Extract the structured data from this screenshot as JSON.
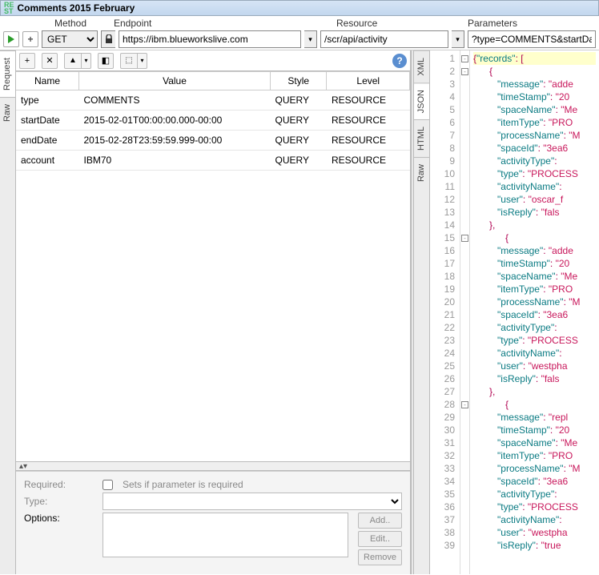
{
  "title": "Comments 2015 February",
  "toolbar": {
    "method_label": "Method",
    "endpoint_label": "Endpoint",
    "resource_label": "Resource",
    "parameters_label": "Parameters",
    "method_value": "GET",
    "endpoint_value": "https://ibm.blueworkslive.com",
    "resource_value": "/scr/api/activity",
    "parameters_value": "?type=COMMENTS&startDat"
  },
  "left_tabs": [
    "Request",
    "Raw"
  ],
  "left_tabs_active": 0,
  "right_tabs": [
    "XML",
    "JSON",
    "HTML",
    "Raw"
  ],
  "right_tabs_active": 1,
  "table": {
    "headers": [
      "Name",
      "Value",
      "Style",
      "Level"
    ],
    "rows": [
      {
        "name": "type",
        "value": "COMMENTS",
        "style": "QUERY",
        "level": "RESOURCE"
      },
      {
        "name": "startDate",
        "value": "2015-02-01T00:00:00.000-00:00",
        "style": "QUERY",
        "level": "RESOURCE"
      },
      {
        "name": "endDate",
        "value": "2015-02-28T23:59:59.999-00:00",
        "style": "QUERY",
        "level": "RESOURCE"
      },
      {
        "name": "account",
        "value": "IBM70",
        "style": "QUERY",
        "level": "RESOURCE"
      }
    ]
  },
  "bottom": {
    "required_label": "Required:",
    "required_text": "Sets if parameter is required",
    "type_label": "Type:",
    "options_label": "Options:",
    "btn_add": "Add..",
    "btn_edit": "Edit..",
    "btn_remove": "Remove"
  },
  "json_lines": [
    {
      "n": 1,
      "fold": "-",
      "hl": true,
      "t": [
        [
          "brace",
          "{"
        ],
        [
          "key",
          "\"records\""
        ],
        [
          "punc",
          ": ["
        ]
      ]
    },
    {
      "n": 2,
      "fold": "-",
      "t": [
        [
          "plain",
          "      "
        ],
        [
          "brace",
          "{"
        ]
      ]
    },
    {
      "n": 3,
      "t": [
        [
          "plain",
          "         "
        ],
        [
          "key",
          "\"message\""
        ],
        [
          "punc",
          ": "
        ],
        [
          "str",
          "\"adde"
        ]
      ]
    },
    {
      "n": 4,
      "t": [
        [
          "plain",
          "         "
        ],
        [
          "key",
          "\"timeStamp\""
        ],
        [
          "punc",
          ": "
        ],
        [
          "str",
          "\"20"
        ]
      ]
    },
    {
      "n": 5,
      "t": [
        [
          "plain",
          "         "
        ],
        [
          "key",
          "\"spaceName\""
        ],
        [
          "punc",
          ": "
        ],
        [
          "str",
          "\"Me"
        ]
      ]
    },
    {
      "n": 6,
      "t": [
        [
          "plain",
          "         "
        ],
        [
          "key",
          "\"itemType\""
        ],
        [
          "punc",
          ": "
        ],
        [
          "str",
          "\"PRO"
        ]
      ]
    },
    {
      "n": 7,
      "t": [
        [
          "plain",
          "         "
        ],
        [
          "key",
          "\"processName\""
        ],
        [
          "punc",
          ": "
        ],
        [
          "str",
          "\"M"
        ]
      ]
    },
    {
      "n": 8,
      "t": [
        [
          "plain",
          "         "
        ],
        [
          "key",
          "\"spaceId\""
        ],
        [
          "punc",
          ": "
        ],
        [
          "str",
          "\"3ea6"
        ]
      ]
    },
    {
      "n": 9,
      "t": [
        [
          "plain",
          "         "
        ],
        [
          "key",
          "\"activityType\""
        ],
        [
          "punc",
          ":"
        ]
      ]
    },
    {
      "n": 10,
      "t": [
        [
          "plain",
          "         "
        ],
        [
          "key",
          "\"type\""
        ],
        [
          "punc",
          ": "
        ],
        [
          "str",
          "\"PROCESS"
        ]
      ]
    },
    {
      "n": 11,
      "t": [
        [
          "plain",
          "         "
        ],
        [
          "key",
          "\"activityName\""
        ],
        [
          "punc",
          ":"
        ]
      ]
    },
    {
      "n": 12,
      "t": [
        [
          "plain",
          "         "
        ],
        [
          "key",
          "\"user\""
        ],
        [
          "punc",
          ": "
        ],
        [
          "str",
          "\"oscar_f"
        ]
      ]
    },
    {
      "n": 13,
      "t": [
        [
          "plain",
          "         "
        ],
        [
          "key",
          "\"isReply\""
        ],
        [
          "punc",
          ": "
        ],
        [
          "str",
          "\"fals"
        ]
      ]
    },
    {
      "n": 14,
      "t": [
        [
          "plain",
          "      "
        ],
        [
          "brace",
          "},"
        ]
      ]
    },
    {
      "n": 15,
      "fold": "-",
      "t": [
        [
          "plain",
          "            "
        ],
        [
          "brace",
          "{"
        ]
      ]
    },
    {
      "n": 16,
      "t": [
        [
          "plain",
          "         "
        ],
        [
          "key",
          "\"message\""
        ],
        [
          "punc",
          ": "
        ],
        [
          "str",
          "\"adde"
        ]
      ]
    },
    {
      "n": 17,
      "t": [
        [
          "plain",
          "         "
        ],
        [
          "key",
          "\"timeStamp\""
        ],
        [
          "punc",
          ": "
        ],
        [
          "str",
          "\"20"
        ]
      ]
    },
    {
      "n": 18,
      "t": [
        [
          "plain",
          "         "
        ],
        [
          "key",
          "\"spaceName\""
        ],
        [
          "punc",
          ": "
        ],
        [
          "str",
          "\"Me"
        ]
      ]
    },
    {
      "n": 19,
      "t": [
        [
          "plain",
          "         "
        ],
        [
          "key",
          "\"itemType\""
        ],
        [
          "punc",
          ": "
        ],
        [
          "str",
          "\"PRO"
        ]
      ]
    },
    {
      "n": 20,
      "t": [
        [
          "plain",
          "         "
        ],
        [
          "key",
          "\"processName\""
        ],
        [
          "punc",
          ": "
        ],
        [
          "str",
          "\"M"
        ]
      ]
    },
    {
      "n": 21,
      "t": [
        [
          "plain",
          "         "
        ],
        [
          "key",
          "\"spaceId\""
        ],
        [
          "punc",
          ": "
        ],
        [
          "str",
          "\"3ea6"
        ]
      ]
    },
    {
      "n": 22,
      "t": [
        [
          "plain",
          "         "
        ],
        [
          "key",
          "\"activityType\""
        ],
        [
          "punc",
          ":"
        ]
      ]
    },
    {
      "n": 23,
      "t": [
        [
          "plain",
          "         "
        ],
        [
          "key",
          "\"type\""
        ],
        [
          "punc",
          ": "
        ],
        [
          "str",
          "\"PROCESS"
        ]
      ]
    },
    {
      "n": 24,
      "t": [
        [
          "plain",
          "         "
        ],
        [
          "key",
          "\"activityName\""
        ],
        [
          "punc",
          ":"
        ]
      ]
    },
    {
      "n": 25,
      "t": [
        [
          "plain",
          "         "
        ],
        [
          "key",
          "\"user\""
        ],
        [
          "punc",
          ": "
        ],
        [
          "str",
          "\"westpha"
        ]
      ]
    },
    {
      "n": 26,
      "t": [
        [
          "plain",
          "         "
        ],
        [
          "key",
          "\"isReply\""
        ],
        [
          "punc",
          ": "
        ],
        [
          "str",
          "\"fals"
        ]
      ]
    },
    {
      "n": 27,
      "t": [
        [
          "plain",
          "      "
        ],
        [
          "brace",
          "},"
        ]
      ]
    },
    {
      "n": 28,
      "fold": "-",
      "t": [
        [
          "plain",
          "            "
        ],
        [
          "brace",
          "{"
        ]
      ]
    },
    {
      "n": 29,
      "t": [
        [
          "plain",
          "         "
        ],
        [
          "key",
          "\"message\""
        ],
        [
          "punc",
          ": "
        ],
        [
          "str",
          "\"repl"
        ]
      ]
    },
    {
      "n": 30,
      "t": [
        [
          "plain",
          "         "
        ],
        [
          "key",
          "\"timeStamp\""
        ],
        [
          "punc",
          ": "
        ],
        [
          "str",
          "\"20"
        ]
      ]
    },
    {
      "n": 31,
      "t": [
        [
          "plain",
          "         "
        ],
        [
          "key",
          "\"spaceName\""
        ],
        [
          "punc",
          ": "
        ],
        [
          "str",
          "\"Me"
        ]
      ]
    },
    {
      "n": 32,
      "t": [
        [
          "plain",
          "         "
        ],
        [
          "key",
          "\"itemType\""
        ],
        [
          "punc",
          ": "
        ],
        [
          "str",
          "\"PRO"
        ]
      ]
    },
    {
      "n": 33,
      "t": [
        [
          "plain",
          "         "
        ],
        [
          "key",
          "\"processName\""
        ],
        [
          "punc",
          ": "
        ],
        [
          "str",
          "\"M"
        ]
      ]
    },
    {
      "n": 34,
      "t": [
        [
          "plain",
          "         "
        ],
        [
          "key",
          "\"spaceId\""
        ],
        [
          "punc",
          ": "
        ],
        [
          "str",
          "\"3ea6"
        ]
      ]
    },
    {
      "n": 35,
      "t": [
        [
          "plain",
          "         "
        ],
        [
          "key",
          "\"activityType\""
        ],
        [
          "punc",
          ":"
        ]
      ]
    },
    {
      "n": 36,
      "t": [
        [
          "plain",
          "         "
        ],
        [
          "key",
          "\"type\""
        ],
        [
          "punc",
          ": "
        ],
        [
          "str",
          "\"PROCESS"
        ]
      ]
    },
    {
      "n": 37,
      "t": [
        [
          "plain",
          "         "
        ],
        [
          "key",
          "\"activityName\""
        ],
        [
          "punc",
          ":"
        ]
      ]
    },
    {
      "n": 38,
      "t": [
        [
          "plain",
          "         "
        ],
        [
          "key",
          "\"user\""
        ],
        [
          "punc",
          ": "
        ],
        [
          "str",
          "\"westpha"
        ]
      ]
    },
    {
      "n": 39,
      "t": [
        [
          "plain",
          "         "
        ],
        [
          "key",
          "\"isReply\""
        ],
        [
          "punc",
          ": "
        ],
        [
          "str",
          "\"true"
        ]
      ]
    }
  ]
}
